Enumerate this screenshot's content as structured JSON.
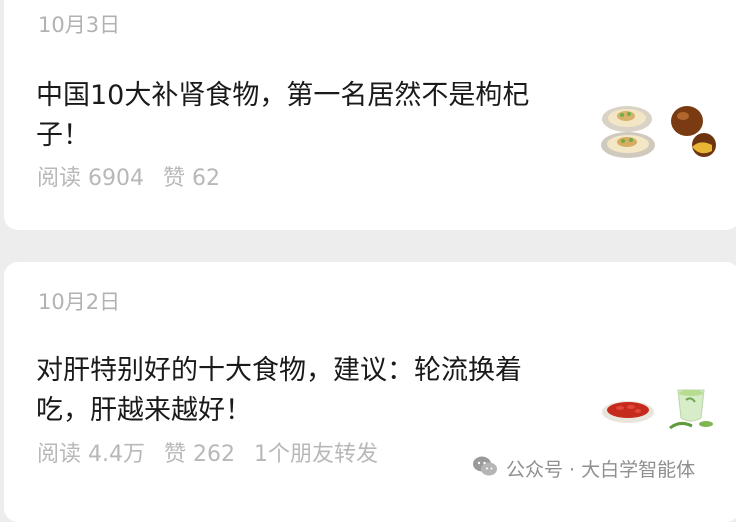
{
  "articles": [
    {
      "date": "10月3日",
      "title_line1": "中国10大补肾食物，第一名居然不是枸杞",
      "title_line2": "子！",
      "reads": "阅读 6904",
      "likes": "赞 62",
      "thumbnail": "oysters-and-chestnuts-image"
    },
    {
      "date": "10月2日",
      "title_line1": "对肝特别好的十大食物，建议：轮流换着",
      "title_line2": "吃，肝越来越好！",
      "reads": "阅读 4.4万",
      "likes": "赞 262",
      "friends_shared": "1个朋友转发",
      "thumbnail": "goji-and-green-tea-image"
    }
  ],
  "watermark": {
    "icon": "wechat-icon",
    "text": "公众号 · 大白学智能体"
  },
  "colors": {
    "background": "#ededed",
    "card": "#ffffff",
    "title": "#1a1a1a",
    "meta": "#b2b2b2"
  }
}
